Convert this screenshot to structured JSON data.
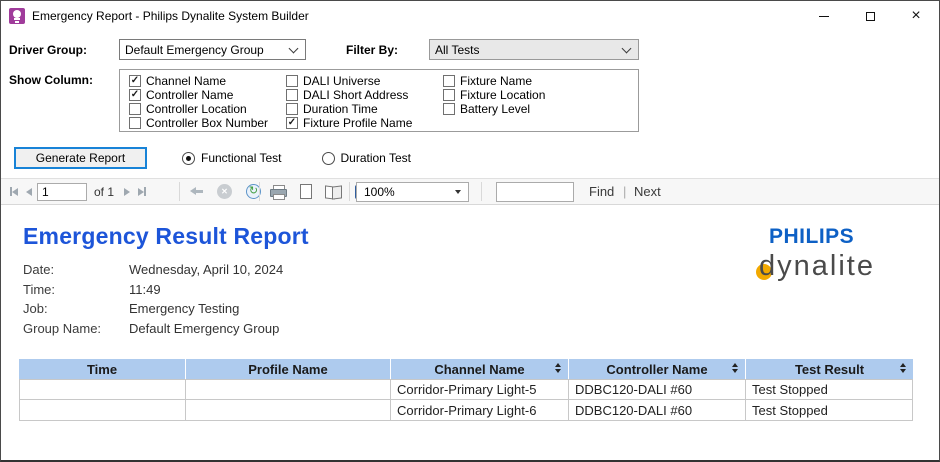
{
  "window": {
    "title": "Emergency Report - Philips Dynalite System Builder"
  },
  "form": {
    "driver_group_label": "Driver Group:",
    "driver_group_value": "Default Emergency Group",
    "filter_by_label": "Filter By:",
    "filter_by_value": "All Tests",
    "show_column_label": "Show Column:",
    "checkbox_columns": [
      [
        {
          "label": "Channel Name",
          "checked": true
        },
        {
          "label": "Controller Name",
          "checked": true
        },
        {
          "label": "Controller Location",
          "checked": false
        },
        {
          "label": "Controller Box Number",
          "checked": false
        }
      ],
      [
        {
          "label": "DALI Universe",
          "checked": false
        },
        {
          "label": "DALI Short Address",
          "checked": false
        },
        {
          "label": "Duration Time",
          "checked": false
        },
        {
          "label": "Fixture Profile Name",
          "checked": true
        }
      ],
      [
        {
          "label": "Fixture Name",
          "checked": false
        },
        {
          "label": "Fixture Location",
          "checked": false
        },
        {
          "label": "Battery Level",
          "checked": false
        }
      ]
    ],
    "generate_button": "Generate Report",
    "radios": [
      {
        "label": "Functional Test",
        "selected": true
      },
      {
        "label": "Duration Test",
        "selected": false
      }
    ]
  },
  "toolbar": {
    "page_current": "1",
    "page_of": "of 1",
    "zoom_value": "100%",
    "search_value": "",
    "find_label": "Find",
    "next_label": "Next"
  },
  "report": {
    "title": "Emergency Result Report",
    "logo": {
      "brand": "PHILIPS",
      "sub": "dynalite"
    },
    "fields": [
      {
        "label": "Date:",
        "value": "Wednesday, April 10, 2024"
      },
      {
        "label": "Time:",
        "value": "11:49"
      },
      {
        "label": "Job:",
        "value": "Emergency Testing"
      },
      {
        "label": "Group Name:",
        "value": "Default Emergency Group"
      }
    ],
    "table": {
      "columns": [
        {
          "label": "Time",
          "sortable": false
        },
        {
          "label": "Profile Name",
          "sortable": false
        },
        {
          "label": "Channel Name",
          "sortable": true
        },
        {
          "label": "Controller Name",
          "sortable": true
        },
        {
          "label": "Test Result",
          "sortable": true
        }
      ],
      "rows": [
        [
          "",
          "",
          "Corridor-Primary Light-5",
          "DDBC120-DALI #60",
          "Test Stopped"
        ],
        [
          "",
          "",
          "Corridor-Primary Light-6",
          "DDBC120-DALI #60",
          "Test Stopped"
        ]
      ]
    }
  },
  "colors": {
    "titlebar_icon_purple": "#A03C9B",
    "focus_button_blue": "#1883D7",
    "report_title_blue": "#1D55D9",
    "philips_blue": "#0D60C5",
    "dynalite_gray": "#4A4A4A",
    "dynalite_gold": "#F2A900",
    "table_header_blue": "#AECBEE"
  }
}
